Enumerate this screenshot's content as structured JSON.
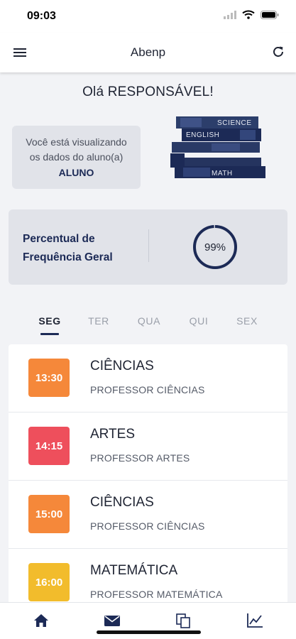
{
  "status_bar": {
    "time": "09:03"
  },
  "app_bar": {
    "title": "Abenp",
    "menu_icon": "menu-icon",
    "refresh_icon": "refresh-icon"
  },
  "greeting": "Olá RESPONSÁVEL!",
  "student_card": {
    "line1": "Você está visualizando",
    "line2": "os dados do aluno(a)",
    "student_name": "ALUNO"
  },
  "books_illustration": {
    "labels": [
      "SCIENCE",
      "ENGLISH",
      "MATH"
    ]
  },
  "frequency": {
    "label_line1": "Percentual de",
    "label_line2": "Frequência Geral",
    "percent_text": "99%",
    "percent_value": 0.99
  },
  "tabs": [
    {
      "label": "SEG",
      "active": true
    },
    {
      "label": "TER",
      "active": false
    },
    {
      "label": "QUA",
      "active": false
    },
    {
      "label": "QUI",
      "active": false
    },
    {
      "label": "SEX",
      "active": false
    }
  ],
  "schedule": [
    {
      "time": "13:30",
      "subject": "CIÊNCIAS",
      "teacher": "PROFESSOR CIÊNCIAS",
      "color": "#f5883a"
    },
    {
      "time": "14:15",
      "subject": "ARTES",
      "teacher": "PROFESSOR ARTES",
      "color": "#ee4f5c"
    },
    {
      "time": "15:00",
      "subject": "CIÊNCIAS",
      "teacher": "PROFESSOR CIÊNCIAS",
      "color": "#f5883a"
    },
    {
      "time": "16:00",
      "subject": "MATEMÁTICA",
      "teacher": "PROFESSOR MATEMÁTICA",
      "color": "#f2bc2c"
    }
  ],
  "bottom_nav": [
    {
      "name": "home-icon"
    },
    {
      "name": "mail-icon"
    },
    {
      "name": "documents-icon"
    },
    {
      "name": "chart-icon"
    }
  ],
  "colors": {
    "navy": "#1c2a56",
    "card_bg": "#e1e3e9",
    "page_bg": "#f2f3f6"
  }
}
